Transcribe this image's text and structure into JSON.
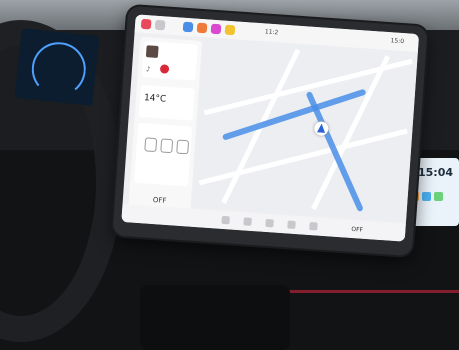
{
  "scene": {
    "description_colors": {
      "dash": "#16181b",
      "screen_bezel": "#2a2c30",
      "map_route": "#4a8ee8",
      "accent_red": "#d9283a",
      "cluster_bg": "#0b1d2e",
      "right_screen_bg": "#eaf2fa"
    }
  },
  "main_display": {
    "status_time": "11:2",
    "status_time_right": "15:0",
    "media": {
      "icons": [
        "music-note-icon",
        "play-icon"
      ]
    },
    "climate": {
      "temperature": "14°C",
      "off_label_left": "OFF",
      "off_label_right": "OFF"
    },
    "map": {
      "icons": [
        "navigation-arrow-icon",
        "route-line"
      ]
    },
    "dock": {
      "icons": [
        "fan-icon",
        "seat-heat-icon",
        "defrost-icon",
        "ac-icon",
        "home-icon",
        "apps-icon"
      ]
    }
  },
  "cluster": {
    "icons": [
      "speedometer-gauge-icon"
    ]
  },
  "right_screen": {
    "time": "15:04"
  }
}
